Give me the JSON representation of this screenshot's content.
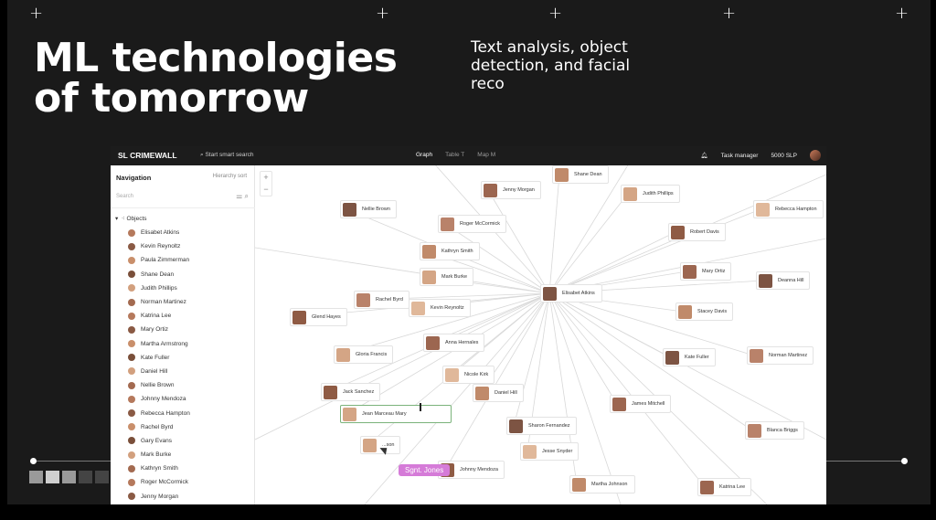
{
  "slide": {
    "title_line1": "ML technologies",
    "title_line2": "of tomorrow",
    "subtitle": "Text analysis, object detection, and facial reco",
    "plus_marks": [
      "+",
      "+",
      "+",
      "+",
      "+"
    ]
  },
  "app": {
    "logo": "SL CRIMEWALL",
    "search_placeholder": "Start smart search",
    "tabs": [
      {
        "label": "Graph",
        "active": true
      },
      {
        "label": "Table T",
        "active": false
      },
      {
        "label": "Map M",
        "active": false
      }
    ],
    "task_manager": "Task manager",
    "credits": "5000 SLP",
    "zoom_in": "+",
    "zoom_out": "−"
  },
  "sidebar": {
    "title": "Navigation",
    "sort_label": "Hierarchy sort",
    "search_placeholder": "Search",
    "objects_label": "Objects",
    "items": [
      "Elisabet Atkins",
      "Kevin Reynoltz",
      "Paula Zimmerman",
      "Shane Dean",
      "Judith Phillips",
      "Norman Martinez",
      "Katrina Lee",
      "Mary Ortiz",
      "Martha Armstrong",
      "Kate Fuller",
      "Daniel Hill",
      "Nellie Brown",
      "Johnny Mendoza",
      "Rebecca Hampton",
      "Rachel Byrd",
      "Gary Evans",
      "Mark Burke",
      "Kathryn Smith",
      "Roger McCormick",
      "Jenny Morgan"
    ]
  },
  "graph": {
    "center": "Elisabet Atkins",
    "nodes": [
      "Shane Dean",
      "Jenny Morgan",
      "Judith Phillips",
      "Nellie Brown",
      "Roger McCormick",
      "Rebecca Hampton",
      "Robert Davis",
      "Kathryn Smith",
      "Mary Ortiz",
      "Mark Burke",
      "Deanna Hill",
      "Rachel Byrd",
      "Kevin Reynoltz",
      "Glend Hayes",
      "Stacey Davis",
      "Anna Hernales",
      "Gloria Francis",
      "Kate Fuller",
      "Norman Martinez",
      "Nicole Kirk",
      "Jack Sanchez",
      "Daniel Hill",
      "James Mitchell",
      "Jean Marceau Mary",
      "Sharon Fernandez",
      "Blanca Briggs",
      "Jesse Snyder",
      "Johnny Mendoza",
      "Martha Johnson",
      "Katrina Lee",
      "...son"
    ],
    "tag_label": "Sgnt. Jones"
  },
  "colors": {
    "slide_bg": "#1a1a1a",
    "tag": "#d57bd8",
    "highlight_border": "#7bb37b"
  }
}
